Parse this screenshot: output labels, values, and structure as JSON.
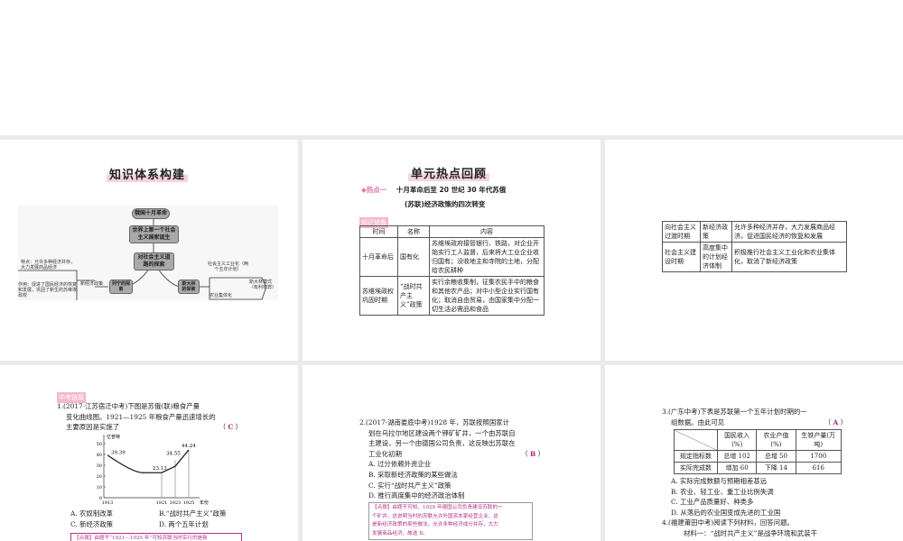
{
  "slide1": {
    "title": "知识体系构建",
    "nodes": {
      "revolution": "俄国十月革命",
      "first_state": "世界上第一个社会主义国家诞生",
      "explore": "对社会主义道路的探索",
      "lenin": "列宁的探索",
      "stalin": "斯大林的探索"
    },
    "left": {
      "nep": "新经济政策",
      "feature": "特点：允许多种经济并存，大力发展商品经济",
      "effect": "作用：促进了国民经济的恢复和发展，巩固了新生的苏维埃政权"
    },
    "right": {
      "industrialization": "社会主义工业化（两个五年计划）",
      "collectivization": "农业集体化",
      "model": "斯大林模式（有利有弊）"
    }
  },
  "slide2": {
    "title": "单元热点回顾",
    "hot_label": "◆热点一",
    "hot_text1": "十月革命后至 20 世纪 30 年代苏俄",
    "hot_text2": "(苏联)经济政策的四次转变",
    "tag": "知识储备",
    "headers": [
      "时间",
      "名称",
      "内容"
    ],
    "rows": [
      [
        "十月革命后",
        "国有化",
        "苏维埃政府接管银行、铁路，对企业开始实行工人监督，后来将大工业企业收归国有；没收地主和寺院的土地，分配给农民耕种"
      ],
      [
        "苏维埃政权巩固时期",
        "“战时共产主义”政策",
        "实行余粮收集制，征集农民手中的粮食和其他农产品；对中小型企业实行国有化；取消自由贸易，由国家集中分配一切生活必需品和食品"
      ]
    ]
  },
  "slide3": {
    "rows": [
      [
        "向社会主义过渡时期",
        "新经济政策",
        "允许多种经济并存，大力发展商品经济，促进国民经济的恢复和发展"
      ],
      [
        "社会主义建设时期",
        "高度集中的计划经济体制",
        "积极推行社会主义工业化和农业集体化，取消了新经济政策"
      ]
    ]
  },
  "slide4": {
    "tag": "中考链接",
    "q1": "1.(2017·江苏宿迁中考)下图是苏俄(联)粮食产量",
    "q2": "变化曲线图。1921—1925 年粮食产量迅速增长的",
    "q3": "主要原因是实施了",
    "answer_open": "（",
    "answer": "C",
    "answer_close": "）",
    "options": [
      "A. 农奴制改革",
      "B.“战时共产主义”政策",
      "C. 新经济政策",
      "D. 两个五年计划"
    ],
    "tip": "【点拨】由题干“1921—1925 年”可知苏联当时实行的是新"
  },
  "chart_data": {
    "type": "line",
    "ylabel": "亿普特",
    "xlabel": "年份",
    "x": [
      1913,
      1921,
      1923,
      1925
    ],
    "values": [
      39.39,
      23.13,
      34.55,
      44.24
    ],
    "labels": [
      "39.39",
      "23.13",
      "34.55",
      "44.24"
    ],
    "yticks": [
      0,
      10,
      20,
      30,
      40,
      50
    ],
    "xticks": [
      "1913",
      "1921",
      "1923",
      "1925"
    ],
    "ylim": [
      0,
      50
    ]
  },
  "slide5": {
    "lines": [
      "2.(2017·湖南娄底中考)1928 年，苏联按照国家计",
      "划在乌拉尔地区建设两个钾矿矿井，一个由苏联自",
      "主建设，另一个由德国公司负责，这反映出苏联在",
      "工业化初期"
    ],
    "answer": "B",
    "options": [
      "A. 过分依赖外资企业",
      "B. 采取新经济政策的某些做法",
      "C. 实行“战时共产主义”政策",
      "D. 推行高度集中的经济政治体制"
    ],
    "tip": [
      "【点拨】由题干可知，1928 年德国公司负责建设苏联的一",
      "个矿井，这说明当时的苏联允许外国资本家经营企业，这",
      "是新经济政策的某些做法，允许多种经济成分并存，大力",
      "发展商品经济。故选 B。"
    ]
  },
  "slide6": {
    "lines": [
      "3.(广东中考)下表是苏联第一个五年计划时期的一",
      "组数据。由此可见"
    ],
    "answer": "A",
    "headers": [
      "国民收入(%)",
      "农业产值(%)",
      "生铁产量(万吨)"
    ],
    "rows": [
      [
        "规定指标数",
        "总增 102",
        "总增 50",
        "1700"
      ],
      [
        "实际完成数",
        "增加 60",
        "下降 14",
        "616"
      ]
    ],
    "options": [
      "A. 实际完成数额与预期相差甚远",
      "B. 农业、轻工业、重工业比例失调",
      "C. 工业产品质量好、种类多",
      "D. 从落后的农业国变成先进的工业国"
    ],
    "q4": "4.(福建莆田中考)阅读下列材料，回答问题。",
    "material": "材料一：“战时共产主义”是战争环境和武装干"
  },
  "colors": {
    "accent": "#c0187a",
    "highlight": "#f6d3e0",
    "gap": "#ebebeb"
  }
}
